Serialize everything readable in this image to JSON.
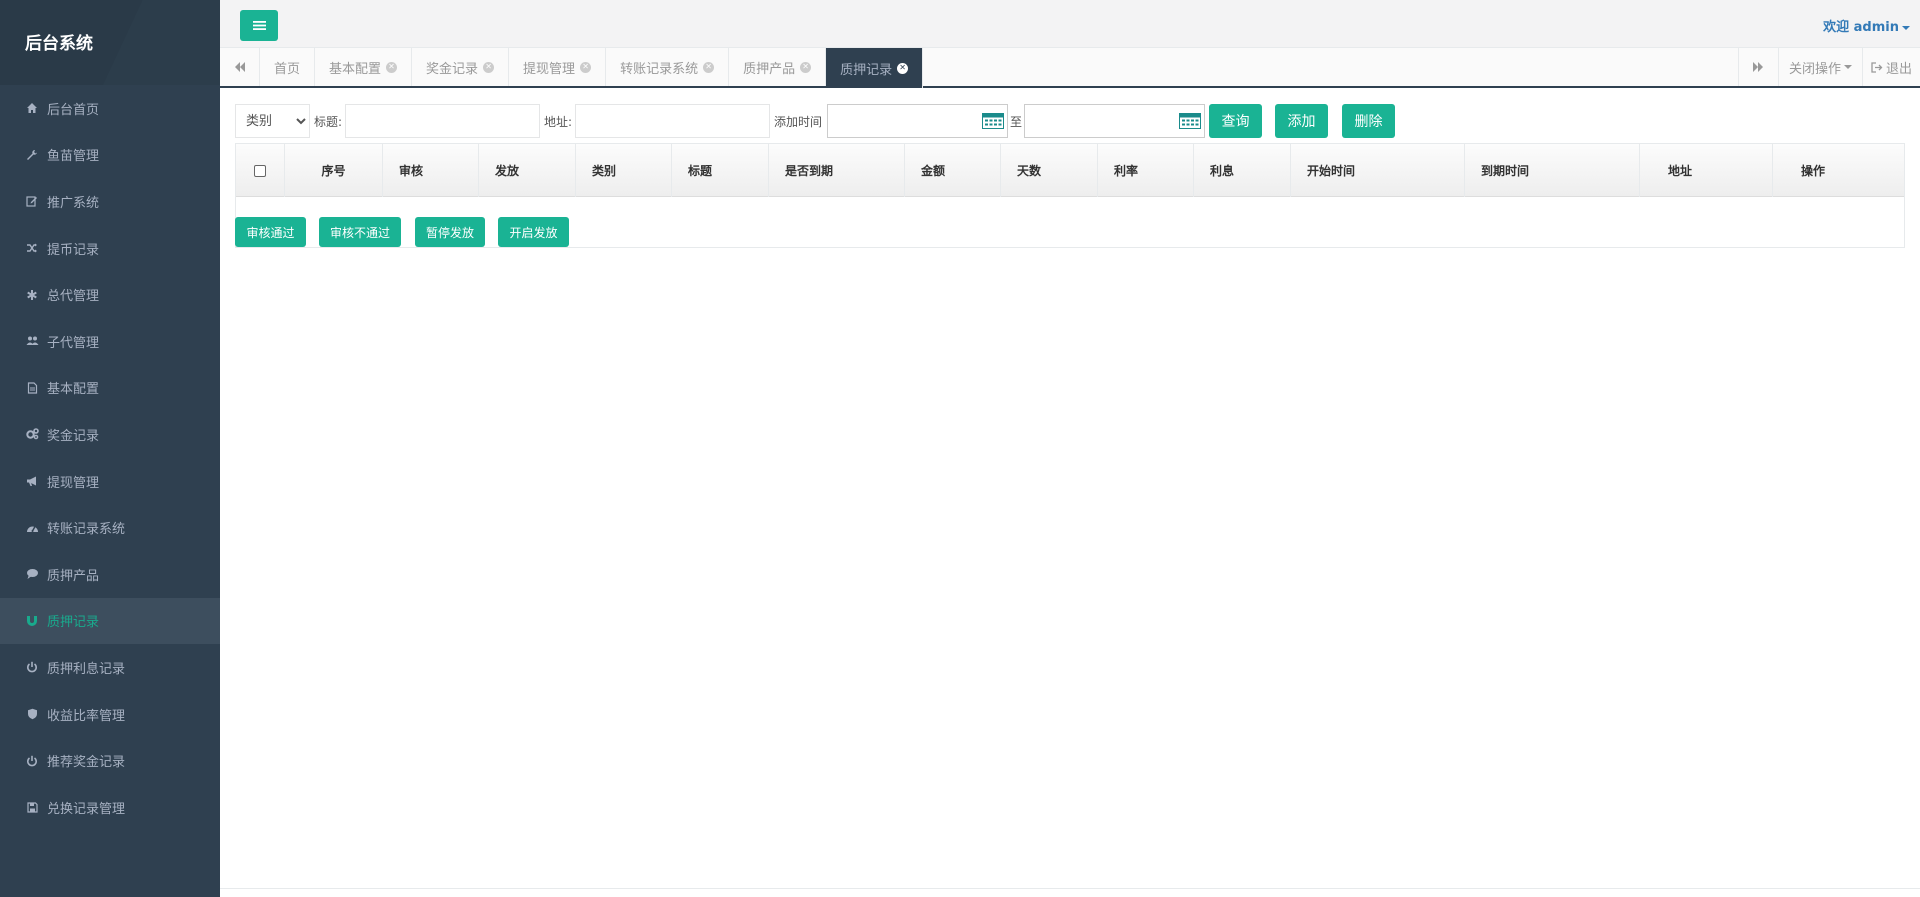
{
  "sidebar": {
    "brand": "后台系统",
    "items": [
      {
        "label": "后台首页",
        "icon": "home-icon"
      },
      {
        "label": "鱼苗管理",
        "icon": "wrench-icon"
      },
      {
        "label": "推广系统",
        "icon": "edit-icon"
      },
      {
        "label": "提币记录",
        "icon": "shuffle-icon"
      },
      {
        "label": "总代管理",
        "icon": "asterisk-icon"
      },
      {
        "label": "子代管理",
        "icon": "users-icon"
      },
      {
        "label": "基本配置",
        "icon": "file-icon"
      },
      {
        "label": "奖金记录",
        "icon": "cogs-icon"
      },
      {
        "label": "提现管理",
        "icon": "bullhorn-icon"
      },
      {
        "label": "转账记录系统",
        "icon": "dashboard-icon"
      },
      {
        "label": "质押产品",
        "icon": "comment-icon"
      },
      {
        "label": "质押记录",
        "icon": "magnet-icon",
        "active": true
      },
      {
        "label": "质押利息记录",
        "icon": "power-icon"
      },
      {
        "label": "收益比率管理",
        "icon": "shield-icon"
      },
      {
        "label": "推荐奖金记录",
        "icon": "power-icon"
      },
      {
        "label": "兑换记录管理",
        "icon": "save-icon"
      }
    ]
  },
  "topbar": {
    "welcome": "欢迎 admin"
  },
  "tabs": {
    "items": [
      {
        "label": "首页",
        "closable": false
      },
      {
        "label": "基本配置",
        "closable": true
      },
      {
        "label": "奖金记录",
        "closable": true
      },
      {
        "label": "提现管理",
        "closable": true
      },
      {
        "label": "转账记录系统",
        "closable": true
      },
      {
        "label": "质押产品",
        "closable": true
      },
      {
        "label": "质押记录",
        "closable": true,
        "active": true
      }
    ],
    "close_ops": "关闭操作",
    "logout": "退出"
  },
  "search": {
    "category_select": "类别",
    "title_label": "标题:",
    "address_label": "地址:",
    "time_label": "添加时间",
    "to_label": "至",
    "query_btn": "查询",
    "add_btn": "添加",
    "delete_btn": "删除"
  },
  "table": {
    "columns": [
      "序号",
      "审核",
      "发放",
      "类别",
      "标题",
      "是否到期",
      "金额",
      "天数",
      "利率",
      "利息",
      "开始时间",
      "到期时间",
      "地址",
      "操作"
    ]
  },
  "bulk": {
    "approve": "审核通过",
    "reject": "审核不通过",
    "pause": "暂停发放",
    "start": "开启发放"
  },
  "colors": {
    "accent": "#1ab394",
    "sidebar_bg": "#2f4050",
    "active_text": "#19aa8d",
    "link": "#337ab7"
  }
}
